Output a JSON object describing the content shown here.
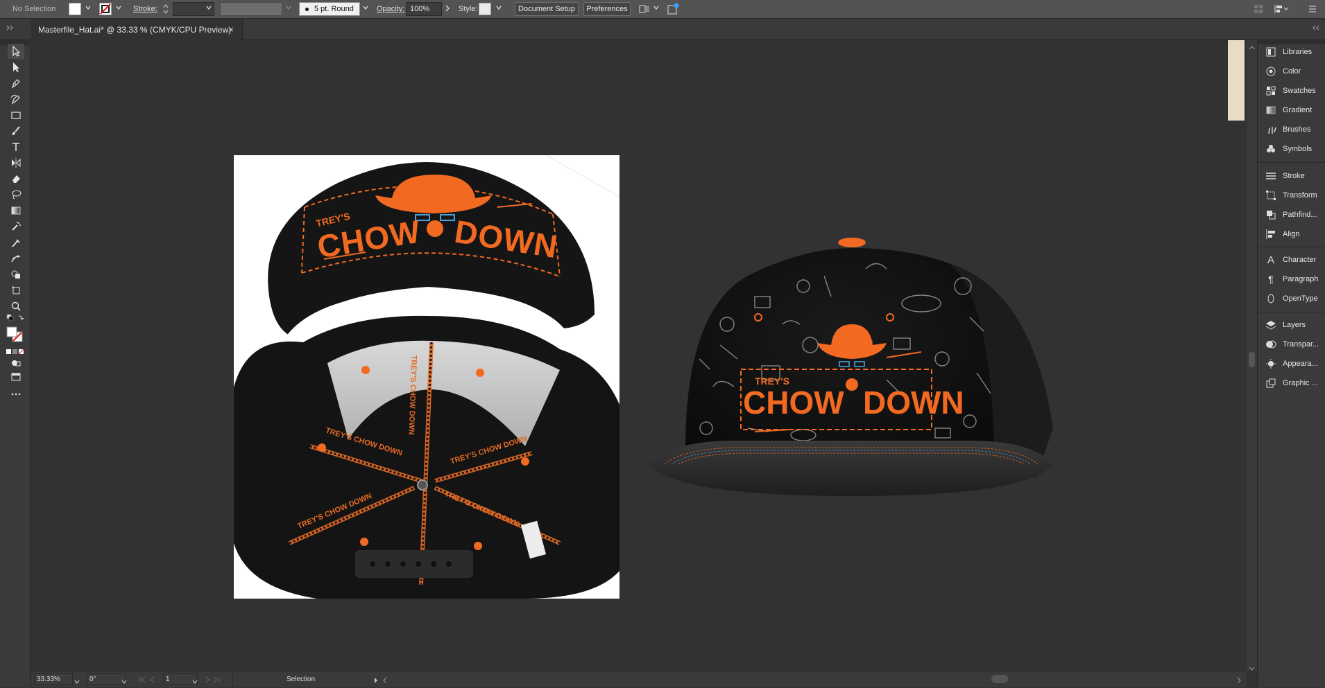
{
  "control_bar": {
    "selection_status": "No Selection",
    "stroke_label": "Stroke:",
    "brush_label": "5 pt. Round",
    "opacity_label": "Opacity:",
    "opacity_value": "100%",
    "style_label": "Style:",
    "document_setup_button": "Document Setup",
    "preferences_button": "Preferences"
  },
  "document_tab": {
    "title": "Masterfile_Hat.ai* @ 33.33 % (CMYK/CPU Preview)",
    "close_glyph": "×"
  },
  "artwork": {
    "brand_small": "TREY'S",
    "brand_word1": "CHOW",
    "brand_word2": "DOWN",
    "strap_text": "TREY'S CHOW DOWN",
    "colors": {
      "accent": "#f26a21",
      "hat": "#131313",
      "brim_top": "#2f2f30",
      "undersky": "#c8c8c8"
    }
  },
  "panels": [
    {
      "label": "Libraries",
      "icon": "libraries-icon"
    },
    {
      "label": "Color",
      "icon": "color-icon"
    },
    {
      "label": "Swatches",
      "icon": "swatches-icon"
    },
    {
      "label": "Gradient",
      "icon": "gradient-icon"
    },
    {
      "label": "Brushes",
      "icon": "brushes-icon"
    },
    {
      "label": "Symbols",
      "icon": "symbols-icon"
    },
    {
      "label": "Stroke",
      "icon": "stroke-icon"
    },
    {
      "label": "Transform",
      "icon": "transform-icon"
    },
    {
      "label": "Pathfind...",
      "icon": "pathfinder-icon"
    },
    {
      "label": "Align",
      "icon": "align-icon"
    },
    {
      "label": "Character",
      "icon": "character-icon"
    },
    {
      "label": "Paragraph",
      "icon": "paragraph-icon"
    },
    {
      "label": "OpenType",
      "icon": "opentype-icon"
    },
    {
      "label": "Layers",
      "icon": "layers-icon"
    },
    {
      "label": "Transpar...",
      "icon": "transparency-icon"
    },
    {
      "label": "Appeara...",
      "icon": "appearance-icon"
    },
    {
      "label": "Graphic ...",
      "icon": "graphic-styles-icon"
    }
  ],
  "status_bar": {
    "zoom": "33.33%",
    "rotation": "0°",
    "artboard_number": "1",
    "current_tool": "Selection"
  },
  "tools": [
    "selection-tool",
    "direct-selection-tool",
    "pen-tool",
    "curvature-tool",
    "rectangle-tool",
    "paintbrush-tool",
    "type-tool",
    "reflect-tool",
    "eraser-tool",
    "lasso-tool",
    "gradient-tool",
    "mesh-tool",
    "eyedropper-tool",
    "blend-tool",
    "shape-builder-tool",
    "artboard-tool",
    "zoom-tool"
  ]
}
